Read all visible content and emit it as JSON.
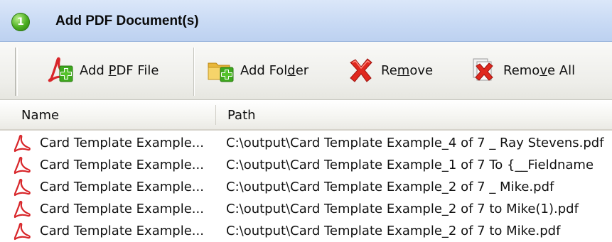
{
  "window": {
    "title": "Add PDF Document(s)",
    "step_number": "1"
  },
  "toolbar": {
    "buttons": [
      {
        "id": "add-pdf-file",
        "pre": "Add ",
        "key": "P",
        "post": "DF File",
        "icon": "add-pdf-icon"
      },
      {
        "id": "add-folder",
        "pre": "Add Fol",
        "key": "d",
        "post": "er",
        "icon": "add-folder-icon"
      },
      {
        "id": "remove",
        "pre": "Re",
        "key": "m",
        "post": "ove",
        "icon": "remove-icon"
      },
      {
        "id": "remove-all",
        "pre": "Remo",
        "key": "v",
        "post": "e All",
        "icon": "remove-all-icon"
      }
    ]
  },
  "list": {
    "columns": [
      "Name",
      "Path"
    ],
    "rows": [
      {
        "name": "Card Template Example...",
        "path": "C:\\output\\Card Template Example_4 of 7 _ Ray Stevens.pdf"
      },
      {
        "name": "Card Template Example...",
        "path": "C:\\output\\Card Template Example_1 of 7 To {__Fieldname"
      },
      {
        "name": "Card Template Example...",
        "path": "C:\\output\\Card Template Example_2 of 7 _ Mike.pdf"
      },
      {
        "name": "Card Template Example...",
        "path": "C:\\output\\Card Template Example_2 of 7 to  Mike(1).pdf"
      },
      {
        "name": "Card Template Example...",
        "path": "C:\\output\\Card Template Example_2 of 7 to  Mike.pdf"
      }
    ]
  },
  "colors": {
    "titlebar": "#c7d9f4",
    "pdf_red": "#d8262a",
    "add_green": "#3ea81e",
    "remove_red": "#e0281e"
  }
}
